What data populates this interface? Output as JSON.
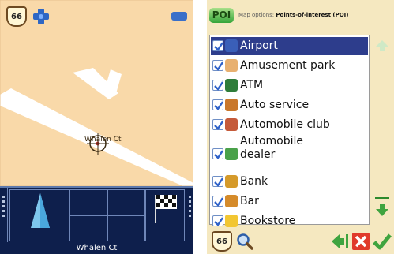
{
  "map_screen": {
    "route_shield": "66",
    "street_label": "Whalen Ct",
    "status_street": "Whalen Ct",
    "colors": {
      "map_bg": "#f9d9a9",
      "road": "#ffffff",
      "dashboard": "#0e1f4c",
      "arrow": "#7ec7ee"
    }
  },
  "poi_screen": {
    "logo": "POI",
    "title_label": "Map options:",
    "title_value": "Points-of-interest (POI)",
    "items": [
      {
        "label": "Airport",
        "checked": true,
        "selected": true,
        "icon": "airplane-icon",
        "color": "#3a5fb8"
      },
      {
        "label": "Amusement park",
        "checked": true,
        "selected": false,
        "icon": "ice-cream-icon",
        "color": "#e8b070"
      },
      {
        "label": "ATM",
        "checked": true,
        "selected": false,
        "icon": "atm-card-icon",
        "color": "#2f7d3a"
      },
      {
        "label": "Auto service",
        "checked": true,
        "selected": false,
        "icon": "wrench-icon",
        "color": "#c9772b"
      },
      {
        "label": "Automobile club",
        "checked": true,
        "selected": false,
        "icon": "tire-icon",
        "color": "#c55a3a"
      },
      {
        "label": "Automobile dealer",
        "checked": true,
        "selected": false,
        "icon": "car-icon",
        "color": "#4aa14a"
      },
      {
        "label": "Bank",
        "checked": true,
        "selected": false,
        "icon": "bank-icon",
        "color": "#d59a2a"
      },
      {
        "label": "Bar",
        "checked": true,
        "selected": false,
        "icon": "beer-icon",
        "color": "#d58b2a"
      },
      {
        "label": "Bookstore",
        "checked": true,
        "selected": false,
        "icon": "book-icon",
        "color": "#f2c632"
      }
    ],
    "footer": {
      "shield": "66"
    },
    "colors": {
      "bg": "#f5e8c0",
      "selected_row": "#2d3d8c",
      "arrow_green": "#3fa43f",
      "close_red": "#e03a2a"
    }
  }
}
